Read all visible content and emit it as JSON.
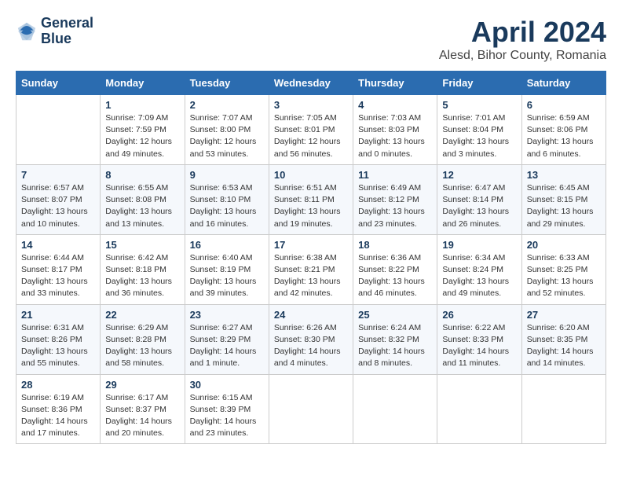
{
  "header": {
    "logo_line1": "General",
    "logo_line2": "Blue",
    "title": "April 2024",
    "subtitle": "Alesd, Bihor County, Romania"
  },
  "weekdays": [
    "Sunday",
    "Monday",
    "Tuesday",
    "Wednesday",
    "Thursday",
    "Friday",
    "Saturday"
  ],
  "weeks": [
    [
      {
        "day": "",
        "info": ""
      },
      {
        "day": "1",
        "info": "Sunrise: 7:09 AM\nSunset: 7:59 PM\nDaylight: 12 hours\nand 49 minutes."
      },
      {
        "day": "2",
        "info": "Sunrise: 7:07 AM\nSunset: 8:00 PM\nDaylight: 12 hours\nand 53 minutes."
      },
      {
        "day": "3",
        "info": "Sunrise: 7:05 AM\nSunset: 8:01 PM\nDaylight: 12 hours\nand 56 minutes."
      },
      {
        "day": "4",
        "info": "Sunrise: 7:03 AM\nSunset: 8:03 PM\nDaylight: 13 hours\nand 0 minutes."
      },
      {
        "day": "5",
        "info": "Sunrise: 7:01 AM\nSunset: 8:04 PM\nDaylight: 13 hours\nand 3 minutes."
      },
      {
        "day": "6",
        "info": "Sunrise: 6:59 AM\nSunset: 8:06 PM\nDaylight: 13 hours\nand 6 minutes."
      }
    ],
    [
      {
        "day": "7",
        "info": "Sunrise: 6:57 AM\nSunset: 8:07 PM\nDaylight: 13 hours\nand 10 minutes."
      },
      {
        "day": "8",
        "info": "Sunrise: 6:55 AM\nSunset: 8:08 PM\nDaylight: 13 hours\nand 13 minutes."
      },
      {
        "day": "9",
        "info": "Sunrise: 6:53 AM\nSunset: 8:10 PM\nDaylight: 13 hours\nand 16 minutes."
      },
      {
        "day": "10",
        "info": "Sunrise: 6:51 AM\nSunset: 8:11 PM\nDaylight: 13 hours\nand 19 minutes."
      },
      {
        "day": "11",
        "info": "Sunrise: 6:49 AM\nSunset: 8:12 PM\nDaylight: 13 hours\nand 23 minutes."
      },
      {
        "day": "12",
        "info": "Sunrise: 6:47 AM\nSunset: 8:14 PM\nDaylight: 13 hours\nand 26 minutes."
      },
      {
        "day": "13",
        "info": "Sunrise: 6:45 AM\nSunset: 8:15 PM\nDaylight: 13 hours\nand 29 minutes."
      }
    ],
    [
      {
        "day": "14",
        "info": "Sunrise: 6:44 AM\nSunset: 8:17 PM\nDaylight: 13 hours\nand 33 minutes."
      },
      {
        "day": "15",
        "info": "Sunrise: 6:42 AM\nSunset: 8:18 PM\nDaylight: 13 hours\nand 36 minutes."
      },
      {
        "day": "16",
        "info": "Sunrise: 6:40 AM\nSunset: 8:19 PM\nDaylight: 13 hours\nand 39 minutes."
      },
      {
        "day": "17",
        "info": "Sunrise: 6:38 AM\nSunset: 8:21 PM\nDaylight: 13 hours\nand 42 minutes."
      },
      {
        "day": "18",
        "info": "Sunrise: 6:36 AM\nSunset: 8:22 PM\nDaylight: 13 hours\nand 46 minutes."
      },
      {
        "day": "19",
        "info": "Sunrise: 6:34 AM\nSunset: 8:24 PM\nDaylight: 13 hours\nand 49 minutes."
      },
      {
        "day": "20",
        "info": "Sunrise: 6:33 AM\nSunset: 8:25 PM\nDaylight: 13 hours\nand 52 minutes."
      }
    ],
    [
      {
        "day": "21",
        "info": "Sunrise: 6:31 AM\nSunset: 8:26 PM\nDaylight: 13 hours\nand 55 minutes."
      },
      {
        "day": "22",
        "info": "Sunrise: 6:29 AM\nSunset: 8:28 PM\nDaylight: 13 hours\nand 58 minutes."
      },
      {
        "day": "23",
        "info": "Sunrise: 6:27 AM\nSunset: 8:29 PM\nDaylight: 14 hours\nand 1 minute."
      },
      {
        "day": "24",
        "info": "Sunrise: 6:26 AM\nSunset: 8:30 PM\nDaylight: 14 hours\nand 4 minutes."
      },
      {
        "day": "25",
        "info": "Sunrise: 6:24 AM\nSunset: 8:32 PM\nDaylight: 14 hours\nand 8 minutes."
      },
      {
        "day": "26",
        "info": "Sunrise: 6:22 AM\nSunset: 8:33 PM\nDaylight: 14 hours\nand 11 minutes."
      },
      {
        "day": "27",
        "info": "Sunrise: 6:20 AM\nSunset: 8:35 PM\nDaylight: 14 hours\nand 14 minutes."
      }
    ],
    [
      {
        "day": "28",
        "info": "Sunrise: 6:19 AM\nSunset: 8:36 PM\nDaylight: 14 hours\nand 17 minutes."
      },
      {
        "day": "29",
        "info": "Sunrise: 6:17 AM\nSunset: 8:37 PM\nDaylight: 14 hours\nand 20 minutes."
      },
      {
        "day": "30",
        "info": "Sunrise: 6:15 AM\nSunset: 8:39 PM\nDaylight: 14 hours\nand 23 minutes."
      },
      {
        "day": "",
        "info": ""
      },
      {
        "day": "",
        "info": ""
      },
      {
        "day": "",
        "info": ""
      },
      {
        "day": "",
        "info": ""
      }
    ]
  ]
}
